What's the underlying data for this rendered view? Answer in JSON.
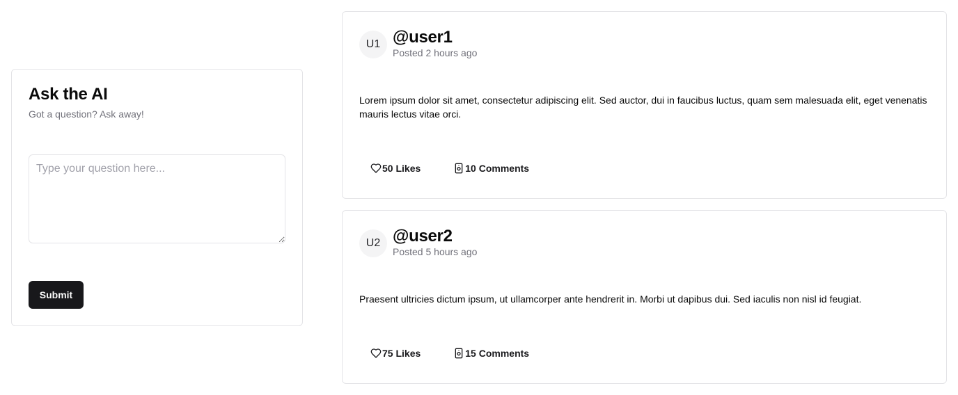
{
  "ask": {
    "title": "Ask the AI",
    "subtitle": "Got a question? Ask away!",
    "input_value": "",
    "input_placeholder": "Type your question here...",
    "submit_label": "Submit"
  },
  "posts": [
    {
      "avatar": "U1",
      "username": "@user1",
      "posted": "Posted 2 hours ago",
      "body": "Lorem ipsum dolor sit amet, consectetur adipiscing elit. Sed auctor, dui in faucibus luctus, quam sem malesuada elit, eget venenatis mauris lectus vitae orci.",
      "likes_label": "50 Likes",
      "comments_label": "10 Comments"
    },
    {
      "avatar": "U2",
      "username": "@user2",
      "posted": "Posted 5 hours ago",
      "body": "Praesent ultricies dictum ipsum, ut ullamcorper ante hendrerit in. Morbi ut dapibus dui. Sed iaculis non nisl id feugiat.",
      "likes_label": "75 Likes",
      "comments_label": "15 Comments"
    }
  ],
  "icons": {
    "like": "heart-icon",
    "comment": "comment-icon"
  },
  "colors": {
    "primary_button": "#18181b",
    "muted_text": "#71717a",
    "border": "#e4e4e7",
    "avatar_bg": "#f4f4f5"
  }
}
